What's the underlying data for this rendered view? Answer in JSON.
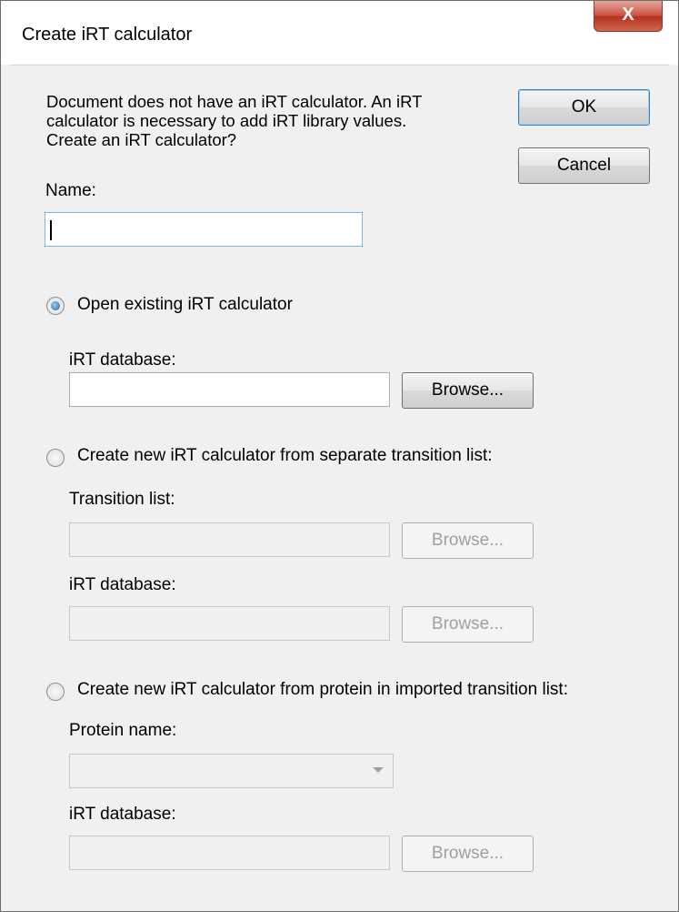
{
  "window": {
    "title": "Create iRT calculator",
    "close_label": "X"
  },
  "prompt": {
    "line1": "Document does not have an iRT calculator.  An iRT",
    "line2": "calculator is necessary to add iRT library values.",
    "line3": "Create an iRT calculator?"
  },
  "buttons": {
    "ok": "OK",
    "cancel": "Cancel"
  },
  "name": {
    "label": "Name:",
    "value": ""
  },
  "option_open": {
    "label": "Open existing iRT calculator",
    "selected": true,
    "db_label": "iRT database:",
    "db_value": "",
    "browse": "Browse..."
  },
  "option_separate": {
    "label": "Create new iRT calculator from separate transition list:",
    "selected": false,
    "transition_label": "Transition list:",
    "transition_value": "",
    "browse1": "Browse...",
    "db_label": "iRT database:",
    "db_value": "",
    "browse2": "Browse..."
  },
  "option_protein": {
    "label": "Create new iRT calculator from protein in imported transition list:",
    "selected": false,
    "protein_label": "Protein name:",
    "protein_value": "",
    "db_label": "iRT database:",
    "db_value": "",
    "browse": "Browse..."
  }
}
